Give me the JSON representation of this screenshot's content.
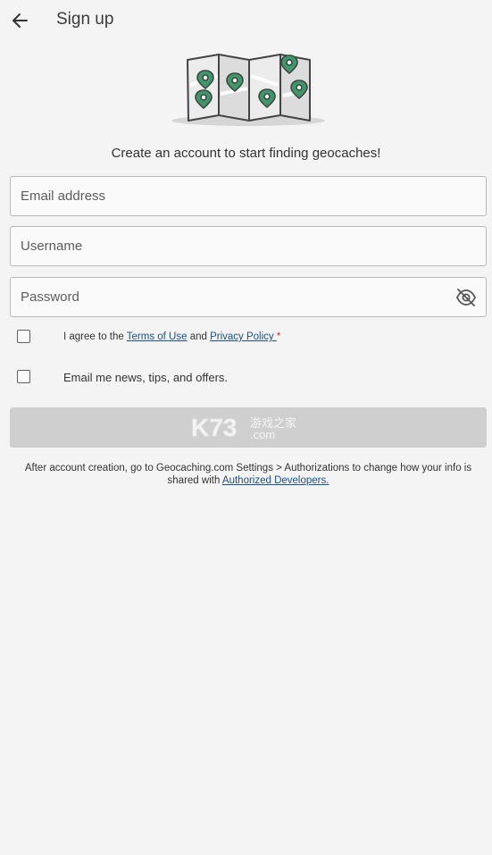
{
  "header": {
    "back_icon": "arrow-left-icon",
    "title": "Sign up"
  },
  "illustration": {
    "icon": "folded-map-with-pins-illustration"
  },
  "tagline": "Create an account to start finding geocaches!",
  "form": {
    "email": {
      "placeholder": "Email address",
      "value": ""
    },
    "username": {
      "placeholder": "Username",
      "value": ""
    },
    "password": {
      "placeholder": "Password",
      "value": "",
      "toggle_icon": "eye-off-icon"
    }
  },
  "agreement": {
    "checked": false,
    "prefix": "I agree to the ",
    "terms_link": "Terms of Use",
    "middle": " and ",
    "privacy_link": "Privacy Policy ",
    "required_mark": "*"
  },
  "newsletter": {
    "checked": false,
    "label": "Email me news, tips, and offers."
  },
  "submit": {
    "label": "",
    "watermark": "K73 游戏之家 .com"
  },
  "footnote": {
    "text": "After account creation, go to Geocaching.com Settings > Authorizations to change how your info is shared with ",
    "link": "Authorized Developers."
  },
  "colors": {
    "background": "#f4f4f4",
    "pin_green": "#3c9a6a",
    "link_blue": "#1f4e8c",
    "required_red": "#d0302e",
    "button_disabled": "#cfcfcf"
  }
}
